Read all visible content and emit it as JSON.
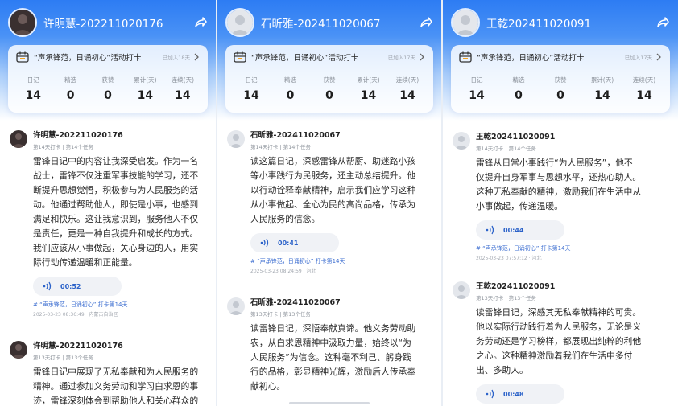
{
  "panels": [
    {
      "user": "许明慧-202211020176",
      "activity": "“声承锋范，日诵初心”活动打卡",
      "joined": "已加入18天",
      "stats": [
        {
          "label": "日记",
          "value": "14"
        },
        {
          "label": "精选",
          "value": "0"
        },
        {
          "label": "获赞",
          "value": "0"
        },
        {
          "label": "累计(天)",
          "value": "14"
        },
        {
          "label": "连续(天)",
          "value": "14"
        }
      ],
      "posts": [
        {
          "name": "许明慧-202211020176",
          "sub": "第14天打卡 | 第14个任务",
          "lines": [
            "雷锋日记中的内容让我深受启发。作为一名",
            "战士，雷锋不仅注重军事技能的学习，还不",
            "断提升思想觉悟，积极参与为人民服务的活",
            "动。他通过帮助他人，即使是小事，也感到",
            "满足和快乐。这让我意识到，服务他人不仅",
            "是责任，更是一种自我提升和成长的方式。",
            "我们应该从小事做起，关心身边的人，用实",
            "际行动传递温暖和正能量。"
          ],
          "duration": "00:52",
          "tag": "# “声承锋范，日诵初心” 打卡第14天",
          "foot": "2025-03-23 08:36:49 · 内蒙古自治区"
        },
        {
          "name": "许明慧-202211020176",
          "sub": "第13天打卡 | 第13个任务",
          "lines": [
            "雷锋日记中展现了无私奉献和为人民服务的",
            "精神。通过参加义务劳动和学习白求恩的事",
            "迹，雷锋深刻体会到帮助他人和关心群众的"
          ]
        }
      ]
    },
    {
      "user": "石昕雅-202411020067",
      "activity": "“声承锋范，日诵初心”活动打卡",
      "joined": "已加入17天",
      "stats": [
        {
          "label": "日记",
          "value": "14"
        },
        {
          "label": "精选",
          "value": "0"
        },
        {
          "label": "获赞",
          "value": "0"
        },
        {
          "label": "累计(天)",
          "value": "14"
        },
        {
          "label": "连续(天)",
          "value": "14"
        }
      ],
      "posts": [
        {
          "name": "石昕雅-202411020067",
          "sub": "第14天打卡 | 第14个任务",
          "lines": [
            "读这篇日记，深感雷锋从帮厨、助迷路小孩",
            "等小事践行为民服务，还主动总结提升。他",
            "以行动诠释奉献精神，启示我们应学习这种",
            "从小事做起、全心为民的高尚品格，传承为",
            "人民服务的信念。"
          ],
          "duration": "00:41",
          "tag": "# “声承锋范，日诵初心” 打卡第14天",
          "foot": "2025-03-23 08:24:59 · 河北"
        },
        {
          "name": "石昕雅-202411020067",
          "sub": "第13天打卡 | 第13个任务",
          "lines": [
            "读雷锋日记，深悟奉献真谛。他义务劳动助",
            "农，从白求恩精神中汲取力量，始终以“为",
            "人民服务”为信念。这种毫不利己、躬身践",
            "行的品格，彰显精神光辉，激励后人传承奉",
            "献初心。"
          ]
        }
      ]
    },
    {
      "user": "王乾202411020091",
      "activity": "“声承锋范，日诵初心”活动打卡",
      "joined": "已加入17天",
      "stats": [
        {
          "label": "日记",
          "value": "14"
        },
        {
          "label": "精选",
          "value": "0"
        },
        {
          "label": "获赞",
          "value": "0"
        },
        {
          "label": "累计(天)",
          "value": "14"
        },
        {
          "label": "连续(天)",
          "value": "14"
        }
      ],
      "posts": [
        {
          "name": "王乾202411020091",
          "sub": "第14天打卡 | 第14个任务",
          "lines": [
            "雷锋从日常小事践行“为人民服务”，他不",
            "仅提升自身军事与思想水平，还热心助人。",
            "这种无私奉献的精神，激励我们在生活中从",
            "小事做起，传递温暖。"
          ],
          "duration": "00:44",
          "tag": "# “声承锋范，日诵初心” 打卡第14天",
          "foot": "2025-03-23 07:57:12 · 河北"
        },
        {
          "name": "王乾202411020091",
          "sub": "第13天打卡 | 第13个任务",
          "lines": [
            "读雷锋日记，深感其无私奉献精神的可贵。",
            "他以实际行动践行着为人民服务，无论是义",
            "务劳动还是学习榜样，都展现出纯粹的利他",
            "之心。这种精神激励着我们在生活中多付",
            "出、多助人。"
          ],
          "duration": "00:48"
        }
      ]
    }
  ],
  "colors": {
    "accent": "#2d7cf3",
    "tag": "#3e6fd1",
    "voice_text": "#2b62c9"
  }
}
